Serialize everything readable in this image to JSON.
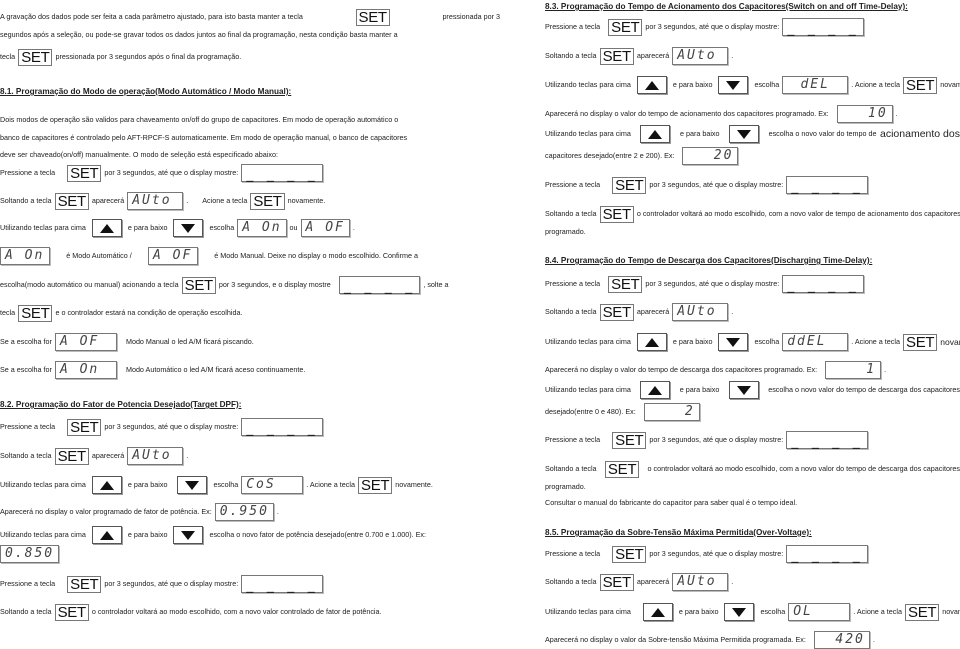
{
  "keys": {
    "set": "SET"
  },
  "displays": {
    "blank": "_ _ _ _",
    "auto": "AUto",
    "aon": "A On",
    "aof": "A OF",
    "cos": "CoS",
    "pf_current": "0.950",
    "pf_new": "0.850",
    "del": "dEL",
    "del_current": "10",
    "del_new": "20",
    "ddel": "ddEL",
    "ddel_current": "1",
    "ddel_new": "2",
    "ol": "OL",
    "ol_current": "420"
  },
  "left": {
    "intro": {
      "l1a": "A gravação dos dados pode ser feita a cada parâmetro ajustado, para isto basta manter a tecla",
      "l1b": "pressionada por 3",
      "l2": "segundos após a seleção, ou pode-se gravar todos os dados juntos ao final da programação, nesta condição basta manter a",
      "l3a": "tecla",
      "l3b": "pressionada por 3 segundos após o final da programação."
    },
    "s81": {
      "heading": "8.1. Programação do Modo de operação(Modo Automático / Modo Manual):",
      "p1": "Dois modos de operação são validos para chaveamento on/off do grupo de capacitores. Em modo de operação automático o",
      "p2": "banco de capacitores é controlado pelo AFT-RPCF-S automaticamente. Em modo de operação manual, o banco de capacitores",
      "p3": "deve ser chaveado(on/off) manualmente. O modo de seleção está especificado abaixo:",
      "press_a": "Pressione a tecla",
      "press_b": "por 3 segundos, até que o display mostre:",
      "release_a": "Soltando a tecla",
      "release_b": "aparecerá",
      "release_c": ".",
      "release_d": "Acione a tecla",
      "release_e": "novamente.",
      "arrows_a": "Utilizando teclas para cima",
      "arrows_b": "e para baixo",
      "arrows_c": "escolha",
      "arrows_d": "ou",
      "arrows_e": ".",
      "def_a": "é Modo Automático /",
      "def_b": "é Modo Manual. Deixe no display o modo escolhido. Confirme a",
      "confirm_a": "escolha(modo automático ou manual) acionando a tecla",
      "confirm_b": "por 3 segundos, e o display mostre",
      "confirm_c": ", solte a",
      "final_a": "tecla",
      "final_b": "e o controlador estará na condição de operação escolhida.",
      "ifof_a": "Se a escolha for",
      "ifof_b": "Modo Manual o led A/M ficará piscando.",
      "ifon_a": "Se a escolha for",
      "ifon_b": "Modo Automático o led A/M ficará aceso continuamente."
    },
    "s82": {
      "heading": "8.2. Programação do Fator de Potencia Desejado(Target DPF):",
      "press_a": "Pressione a tecla",
      "press_b": "por 3 segundos, até que o display mostre:",
      "release_a": "Soltando a tecla",
      "release_b": "aparecerá",
      "release_c": ".",
      "arrows_a": "Utilizando teclas para cima",
      "arrows_b": "e para baixo",
      "arrows_c": "escolha",
      "arrows_d": ". Acione a tecla",
      "arrows_e": "novamente.",
      "shows_a": "Aparecerá no display o valor programado de fator de potência. Ex:",
      "shows_b": ".",
      "choose_a": "Utilizando teclas para cima",
      "choose_b": "e para baixo",
      "choose_c": "escolha o novo fator de potência desejado(entre 0.700 e 1.000). Ex:",
      "press2_a": "Pressione a tecla",
      "press2_b": "por 3 segundos, até que o display mostre:",
      "release2_a": "Soltando a tecla",
      "release2_b": "o controlador voltará ao modo escolhido, com a novo valor controlado de fator de potência."
    }
  },
  "right": {
    "s83": {
      "heading": "8.3. Programação do Tempo de Acionamento dos Capacitores(Switch on and off Time-Delay):",
      "press_a": "Pressione a tecla",
      "press_b": "por 3 segundos, até que o display mostre:",
      "release_a": "Soltando a tecla",
      "release_b": "aparecerá",
      "release_c": ".",
      "arrows_a": "Utilizando teclas para cima",
      "arrows_b": "e para baixo",
      "arrows_c": "escolha",
      "arrows_d": ". Acione a tecla",
      "arrows_e": "novamente.",
      "shows_a": "Aparecerá no display o valor do tempo de acionamento dos capacitores programado. Ex:",
      "shows_b": ".",
      "choose_a": "Utilizando teclas para cima",
      "choose_b": "e para baixo",
      "choose_c": "escolha o novo valor do tempo de",
      "choose_d": "acionamento dos",
      "choose2": "capacitores desejado(entre 2 e 200). Ex:",
      "press2_a": "Pressione a tecla",
      "press2_b": "por 3 segundos, até que o display mostre:",
      "release2_a": "Soltando a tecla",
      "release2_b": "o controlador voltará ao modo escolhido, com a novo valor de tempo de acionamento dos capacitores",
      "release2_c": "programado."
    },
    "s84": {
      "heading": "8.4. Programação do Tempo de Descarga dos Capacitores(Discharging Time-Delay):",
      "press_a": "Pressione a tecla",
      "press_b": "por 3 segundos, até que o display mostre:",
      "release_a": "Soltando a tecla",
      "release_b": "aparecerá",
      "release_c": ".",
      "arrows_a": "Utilizando teclas para cima",
      "arrows_b": "e para baixo",
      "arrows_c": "escolha",
      "arrows_d": ". Acione a tecla",
      "arrows_e": "novamente.",
      "shows_a": "Aparecerá no display o valor do tempo de descarga dos capacitores programado. Ex:",
      "shows_b": ".",
      "choose_a": "Utilizando teclas para cima",
      "choose_b": "e para baixo",
      "choose_c": "escolha o novo valor do tempo de descarga dos capacitores",
      "choose2": "desejado(entre 0 e 480). Ex:",
      "press2_a": "Pressione a tecla",
      "press2_b": "por 3 segundos, até que o display mostre:",
      "release2_a": "Soltando a tecla",
      "release2_b": "o controlador voltará ao modo escolhido, com a novo valor do tempo de descarga dos capacitores",
      "release2_c": "programado.",
      "note": "Consultar o manual do fabricante do capacitor para saber qual é o tempo ideal."
    },
    "s85": {
      "heading": "8.5. Programação da Sobre-Tensão Máxima Permitida(Over-Voltage):",
      "press_a": "Pressione a tecla",
      "press_b": "por 3 segundos, até que o display mostre:",
      "release_a": "Soltando a tecla",
      "release_b": "aparecerá",
      "release_c": ".",
      "arrows_a": "Utilizando teclas para cima",
      "arrows_b": "e para baixo",
      "arrows_c": "escolha",
      "arrows_d": ". Acione a tecla",
      "arrows_e": "novamente.",
      "shows_a": "Aparecerá no display o valor da Sobre-tensão Máxima Permitida programada. Ex:",
      "shows_b": "."
    }
  }
}
